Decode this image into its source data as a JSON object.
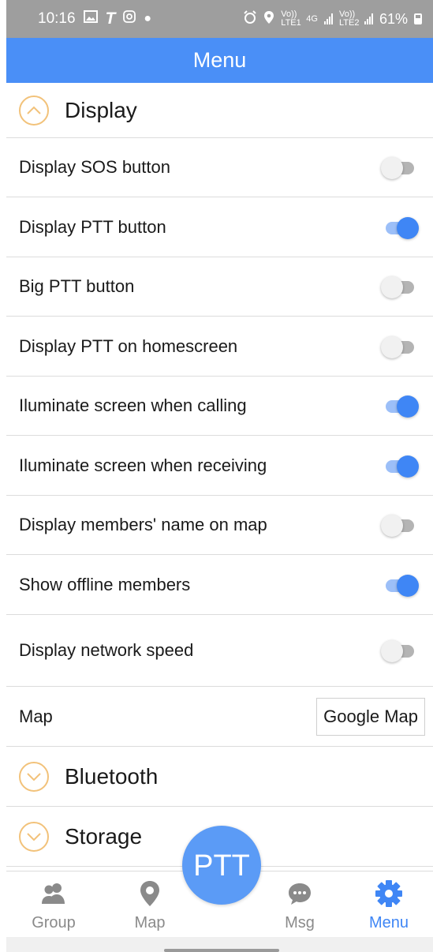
{
  "status_bar": {
    "time": "10:16",
    "left_icons": [
      "image-icon",
      "t-icon",
      "instagram-icon",
      "dot-icon"
    ],
    "volte1": "Vo)) LTE1",
    "network": "4G",
    "volte2": "Vo)) LTE2",
    "battery": "61%"
  },
  "app_bar": {
    "title": "Menu"
  },
  "sections": {
    "display": {
      "label": "Display",
      "expanded": true
    },
    "bluetooth": {
      "label": "Bluetooth",
      "expanded": false
    },
    "storage": {
      "label": "Storage",
      "expanded": false
    }
  },
  "settings": [
    {
      "label": "Display SOS button",
      "on": false
    },
    {
      "label": "Display PTT button",
      "on": true
    },
    {
      "label": "Big PTT button",
      "on": false
    },
    {
      "label": "Display PTT on homescreen",
      "on": false
    },
    {
      "label": "Iluminate screen when calling",
      "on": true
    },
    {
      "label": "Iluminate screen when receiving",
      "on": true
    },
    {
      "label": "Display members' name on map",
      "on": false
    },
    {
      "label": "Show offline members",
      "on": true
    },
    {
      "label": "Display network speed",
      "on": false
    }
  ],
  "map_setting": {
    "label": "Map",
    "value": "Google Map"
  },
  "ptt_button": {
    "label": "PTT"
  },
  "bottom_nav": {
    "group": "Group",
    "map": "Map",
    "msg": "Msg",
    "menu": "Menu",
    "active": "Menu"
  },
  "colors": {
    "accent": "#4a8ff7",
    "toggle_on": "#3f86f5",
    "chevron": "#f2c27a",
    "status_bar": "#9e9e9e"
  }
}
